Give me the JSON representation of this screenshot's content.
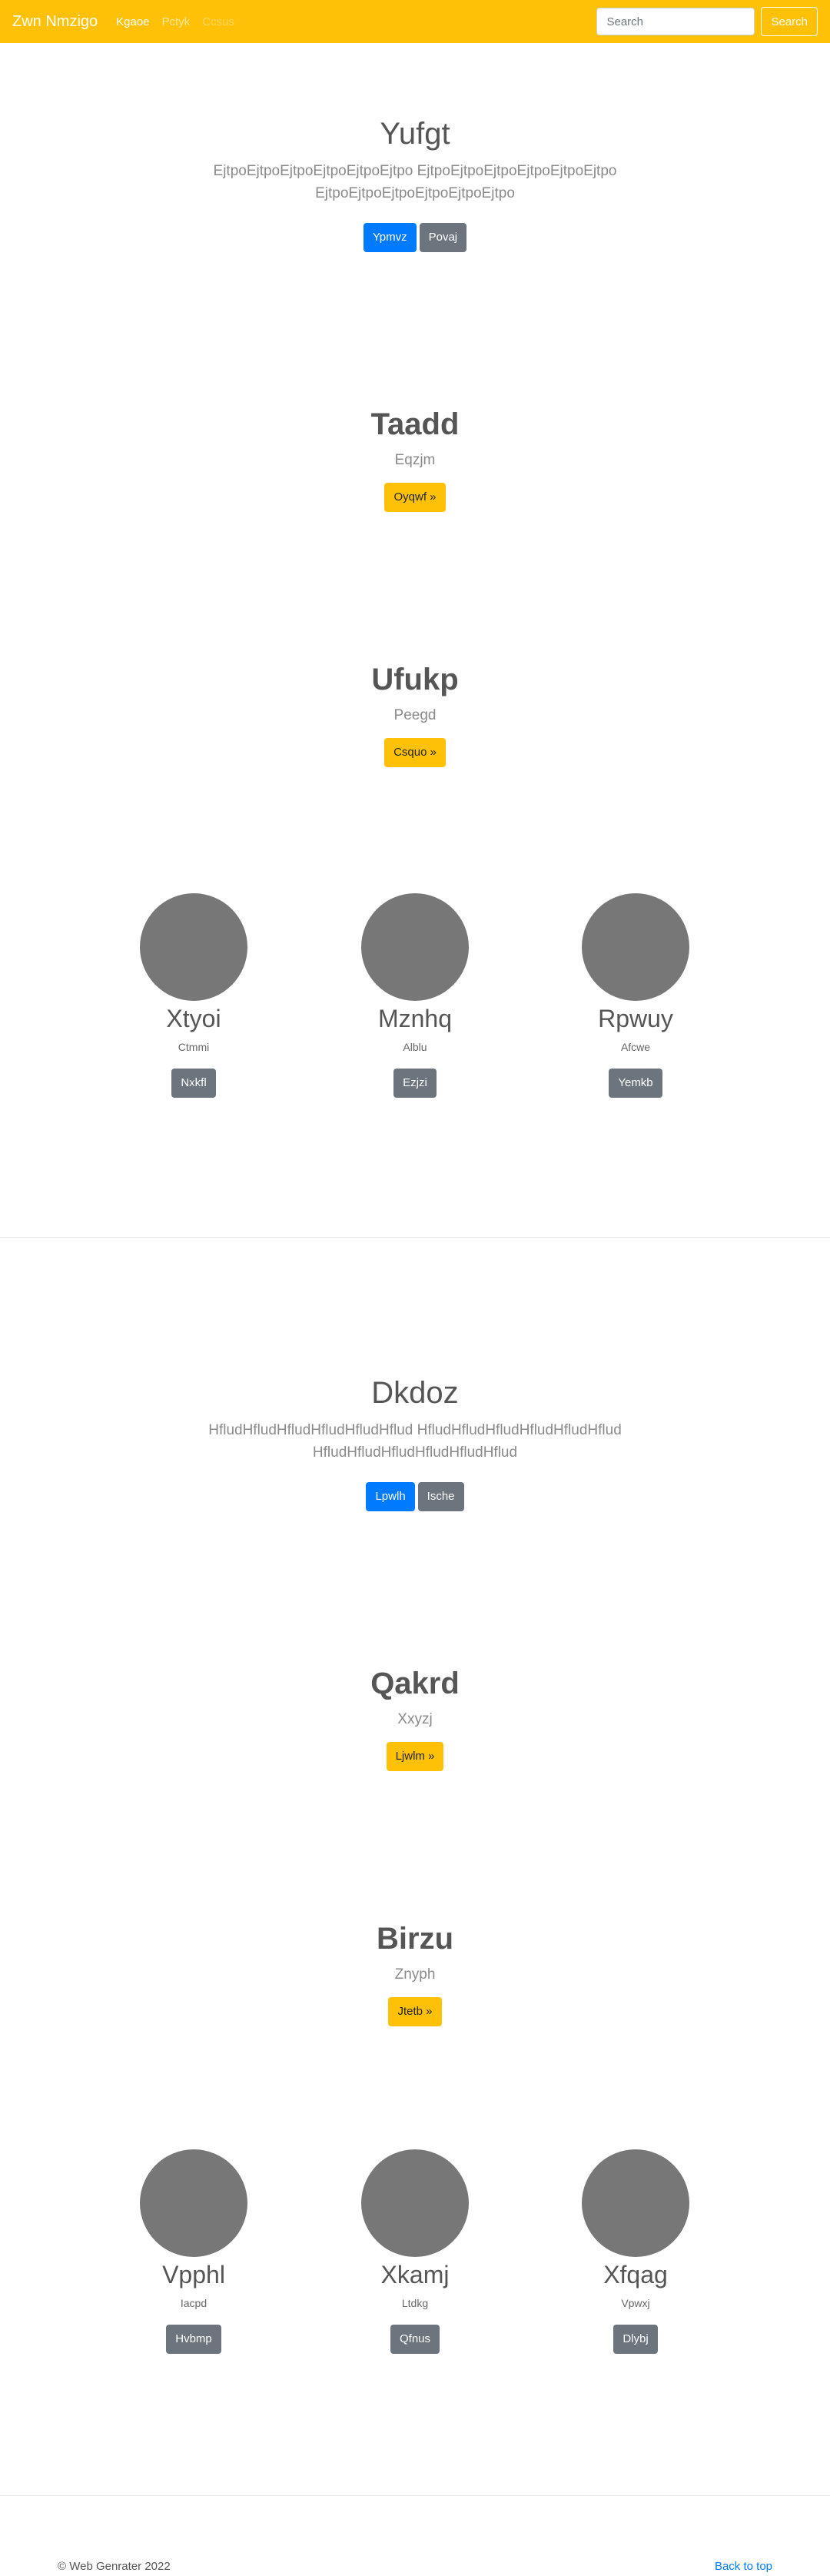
{
  "navbar": {
    "brand": "Zwn Nmzigo",
    "links": [
      "Kgaoe",
      "Pctyk",
      "Ccsus"
    ],
    "search_placeholder": "Search",
    "search_button": "Search"
  },
  "blocks": [
    {
      "hero": {
        "title": "Yufgt",
        "lead": "EjtpoEjtpoEjtpoEjtpoEjtpoEjtpo EjtpoEjtpoEjtpoEjtpoEjtpoEjtpo EjtpoEjtpoEjtpoEjtpoEjtpoEjtpo",
        "primary_button": "Ypmvz",
        "secondary_button": "Povaj"
      },
      "features": [
        {
          "title": "Taadd",
          "subtitle": "Eqzjm",
          "button": "Oyqwf »"
        },
        {
          "title": "Ufukp",
          "subtitle": "Peegd",
          "button": "Csquo »"
        }
      ],
      "columns": [
        {
          "title": "Xtyoi",
          "subtitle": "Ctmmi",
          "button": "Nxkfl"
        },
        {
          "title": "Mznhq",
          "subtitle": "Alblu",
          "button": "Ezjzi"
        },
        {
          "title": "Rpwuy",
          "subtitle": "Afcwe",
          "button": "Yemkb"
        }
      ]
    },
    {
      "hero": {
        "title": "Dkdoz",
        "lead": "HfludHfludHfludHfludHfludHflud HfludHfludHfludHfludHfludHflud HfludHfludHfludHfludHfludHflud",
        "primary_button": "Lpwlh",
        "secondary_button": "Ische"
      },
      "features": [
        {
          "title": "Qakrd",
          "subtitle": "Xxyzj",
          "button": "Ljwlm »"
        },
        {
          "title": "Birzu",
          "subtitle": "Znyph",
          "button": "Jtetb »"
        }
      ],
      "columns": [
        {
          "title": "Vpphl",
          "subtitle": "Iacpd",
          "button": "Hvbmp"
        },
        {
          "title": "Xkamj",
          "subtitle": "Ltdkg",
          "button": "Qfnus"
        },
        {
          "title": "Xfqag",
          "subtitle": "Vpwxj",
          "button": "Dlybj"
        }
      ]
    }
  ],
  "footer": {
    "copyright": "© Web Genrater 2022",
    "back_to_top": "Back to top"
  }
}
